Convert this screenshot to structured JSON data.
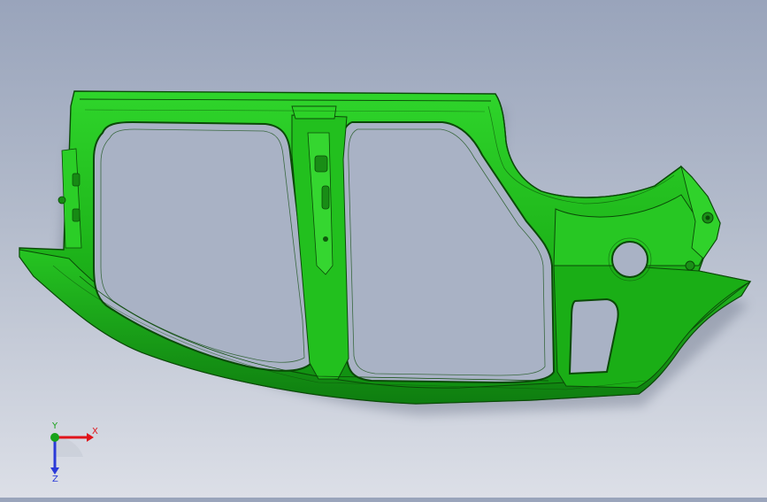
{
  "model": {
    "name": "body-side-panel",
    "color": "#1fb81a",
    "edge_color": "#0b4a08"
  },
  "triad": {
    "x_label": "X",
    "y_label": "Y",
    "z_label": "Z",
    "x_color": "#e0141a",
    "y_color": "#18a21a",
    "z_color": "#2a3ad8"
  }
}
